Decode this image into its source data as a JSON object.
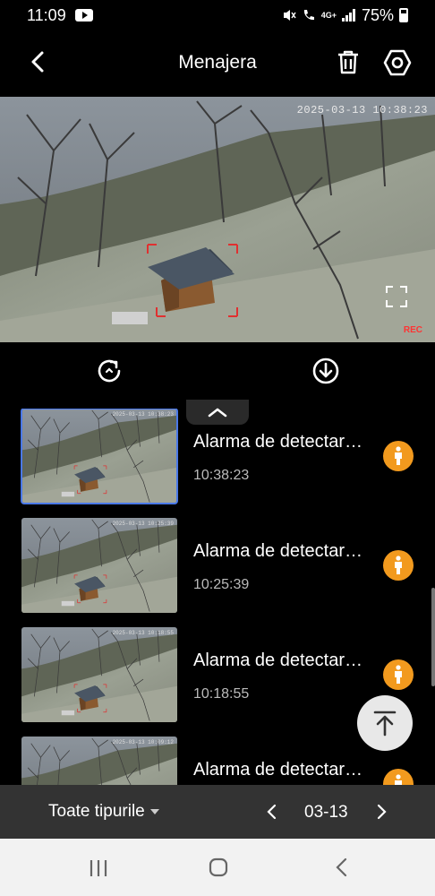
{
  "status_bar": {
    "time": "11:09",
    "network": "4G+",
    "battery": "75%"
  },
  "header": {
    "title": "Menajera"
  },
  "video": {
    "timestamp": "2025-03-13 10:38:23",
    "rec_label": "REC"
  },
  "events": [
    {
      "title": "Alarma de detectare a omului",
      "time": "10:38:23",
      "thumb_ts": "2025-03-13 10:38:23",
      "selected": true
    },
    {
      "title": "Alarma de detectare a omului",
      "time": "10:25:39",
      "thumb_ts": "2025-03-13 10:25:39",
      "selected": false
    },
    {
      "title": "Alarma de detectare a omului",
      "time": "10:18:55",
      "thumb_ts": "2025-03-13 10:18:55",
      "selected": false
    },
    {
      "title": "Alarma de detectare a omului",
      "time": "",
      "thumb_ts": "2025-03-13 10:09:12",
      "selected": false
    }
  ],
  "filter": {
    "type_label": "Toate tipurile",
    "date": "03-13"
  },
  "colors": {
    "accent_badge": "#f29a1e",
    "selection": "#4a78e8"
  }
}
